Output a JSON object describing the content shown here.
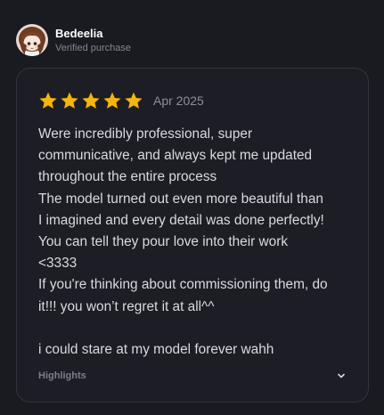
{
  "review": {
    "user": {
      "name": "Bedeelia",
      "badge": "Verified purchase",
      "avatar_icon": "anime-avatar"
    },
    "rating": {
      "value": 5,
      "max": 5,
      "color": "#f5b50a"
    },
    "date": "Apr 2025",
    "lines": [
      "Were incredibly professional, super",
      "communicative, and always kept me updated",
      "throughout the entire process",
      "The model turned out even more beautiful than",
      "I imagined and every detail was done perfectly!",
      "You can tell they pour love into their work",
      "<3333",
      "If you're thinking about commissioning them, do",
      "it!!! you won’t regret it at all^^",
      "",
      "i could stare at my model forever wahh"
    ],
    "highlights_label": "Highlights",
    "expand_icon": "chevron-down-icon"
  }
}
